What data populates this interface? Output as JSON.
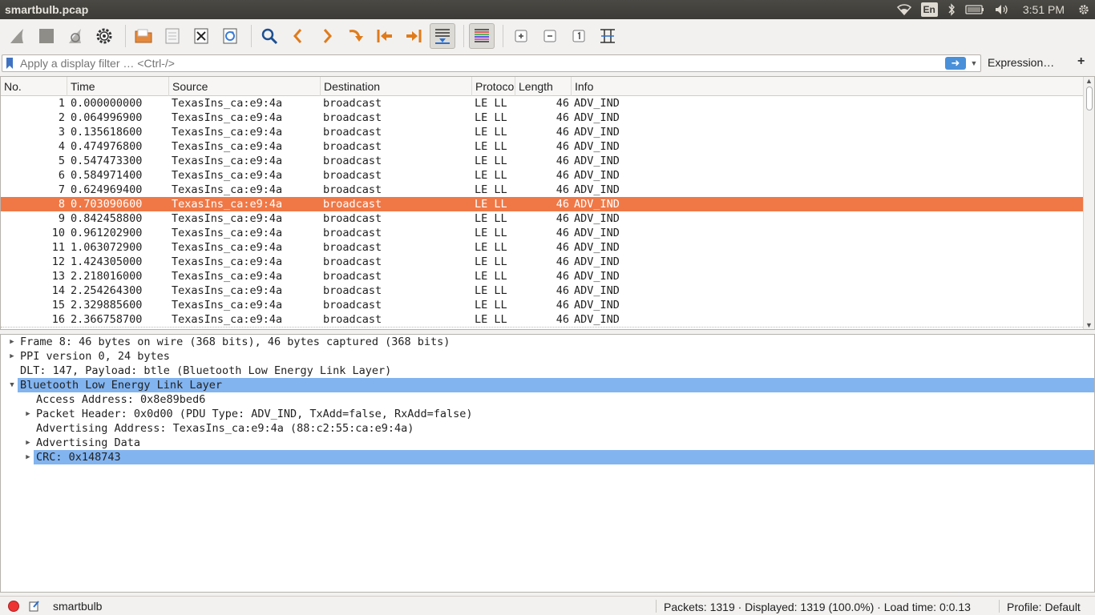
{
  "window": {
    "title": "smartbulb.pcap"
  },
  "panel": {
    "lang": "En",
    "clock": "3:51 PM"
  },
  "filter": {
    "placeholder": "Apply a display filter … <Ctrl-/>",
    "expression_label": "Expression…",
    "add_label": "+"
  },
  "packet_list": {
    "columns": [
      "No.",
      "Time",
      "Source",
      "Destination",
      "Protocol",
      "Length",
      "Info"
    ],
    "header_protocol_shown": "Protoco",
    "selected_index": 7,
    "rows": [
      {
        "no": "1",
        "time": "0.000000000",
        "src": "TexasIns_ca:e9:4a",
        "dst": "broadcast",
        "proto": "LE LL",
        "len": "46",
        "info": "ADV_IND"
      },
      {
        "no": "2",
        "time": "0.064996900",
        "src": "TexasIns_ca:e9:4a",
        "dst": "broadcast",
        "proto": "LE LL",
        "len": "46",
        "info": "ADV_IND"
      },
      {
        "no": "3",
        "time": "0.135618600",
        "src": "TexasIns_ca:e9:4a",
        "dst": "broadcast",
        "proto": "LE LL",
        "len": "46",
        "info": "ADV_IND"
      },
      {
        "no": "4",
        "time": "0.474976800",
        "src": "TexasIns_ca:e9:4a",
        "dst": "broadcast",
        "proto": "LE LL",
        "len": "46",
        "info": "ADV_IND"
      },
      {
        "no": "5",
        "time": "0.547473300",
        "src": "TexasIns_ca:e9:4a",
        "dst": "broadcast",
        "proto": "LE LL",
        "len": "46",
        "info": "ADV_IND"
      },
      {
        "no": "6",
        "time": "0.584971400",
        "src": "TexasIns_ca:e9:4a",
        "dst": "broadcast",
        "proto": "LE LL",
        "len": "46",
        "info": "ADV_IND"
      },
      {
        "no": "7",
        "time": "0.624969400",
        "src": "TexasIns_ca:e9:4a",
        "dst": "broadcast",
        "proto": "LE LL",
        "len": "46",
        "info": "ADV_IND"
      },
      {
        "no": "8",
        "time": "0.703090600",
        "src": "TexasIns_ca:e9:4a",
        "dst": "broadcast",
        "proto": "LE LL",
        "len": "46",
        "info": "ADV_IND"
      },
      {
        "no": "9",
        "time": "0.842458800",
        "src": "TexasIns_ca:e9:4a",
        "dst": "broadcast",
        "proto": "LE LL",
        "len": "46",
        "info": "ADV_IND"
      },
      {
        "no": "10",
        "time": "0.961202900",
        "src": "TexasIns_ca:e9:4a",
        "dst": "broadcast",
        "proto": "LE LL",
        "len": "46",
        "info": "ADV_IND"
      },
      {
        "no": "11",
        "time": "1.063072900",
        "src": "TexasIns_ca:e9:4a",
        "dst": "broadcast",
        "proto": "LE LL",
        "len": "46",
        "info": "ADV_IND"
      },
      {
        "no": "12",
        "time": "1.424305000",
        "src": "TexasIns_ca:e9:4a",
        "dst": "broadcast",
        "proto": "LE LL",
        "len": "46",
        "info": "ADV_IND"
      },
      {
        "no": "13",
        "time": "2.218016000",
        "src": "TexasIns_ca:e9:4a",
        "dst": "broadcast",
        "proto": "LE LL",
        "len": "46",
        "info": "ADV_IND"
      },
      {
        "no": "14",
        "time": "2.254264300",
        "src": "TexasIns_ca:e9:4a",
        "dst": "broadcast",
        "proto": "LE LL",
        "len": "46",
        "info": "ADV_IND"
      },
      {
        "no": "15",
        "time": "2.329885600",
        "src": "TexasIns_ca:e9:4a",
        "dst": "broadcast",
        "proto": "LE LL",
        "len": "46",
        "info": "ADV_IND"
      },
      {
        "no": "16",
        "time": "2.366758700",
        "src": "TexasIns_ca:e9:4a",
        "dst": "broadcast",
        "proto": "LE LL",
        "len": "46",
        "info": "ADV_IND"
      }
    ]
  },
  "details": {
    "rows": [
      {
        "indent": 0,
        "expander": "collapsed",
        "text": "Frame 8: 46 bytes on wire (368 bits), 46 bytes captured (368 bits)",
        "highlight": false
      },
      {
        "indent": 0,
        "expander": "collapsed",
        "text": "PPI version 0, 24 bytes",
        "highlight": false
      },
      {
        "indent": 0,
        "expander": "none",
        "text": "DLT: 147, Payload: btle (Bluetooth Low Energy Link Layer)",
        "highlight": false
      },
      {
        "indent": 0,
        "expander": "expanded",
        "text": "Bluetooth Low Energy Link Layer",
        "highlight": true
      },
      {
        "indent": 1,
        "expander": "none",
        "text": "Access Address: 0x8e89bed6",
        "highlight": false
      },
      {
        "indent": 1,
        "expander": "collapsed",
        "text": "Packet Header: 0x0d00 (PDU Type: ADV_IND, TxAdd=false, RxAdd=false)",
        "highlight": false
      },
      {
        "indent": 1,
        "expander": "none",
        "text": "Advertising Address: TexasIns_ca:e9:4a (88:c2:55:ca:e9:4a)",
        "highlight": false
      },
      {
        "indent": 1,
        "expander": "collapsed",
        "text": "Advertising Data",
        "highlight": false
      },
      {
        "indent": 1,
        "expander": "collapsed",
        "text": "CRC: 0x148743",
        "highlight": true
      }
    ]
  },
  "status": {
    "file": "smartbulb",
    "packets": "Packets: 1319 · Displayed: 1319 (100.0%) · Load time: 0:0.13",
    "profile": "Profile: Default"
  },
  "colors": {
    "selected_row": "#f07846",
    "tree_highlight": "#82b4f0"
  }
}
